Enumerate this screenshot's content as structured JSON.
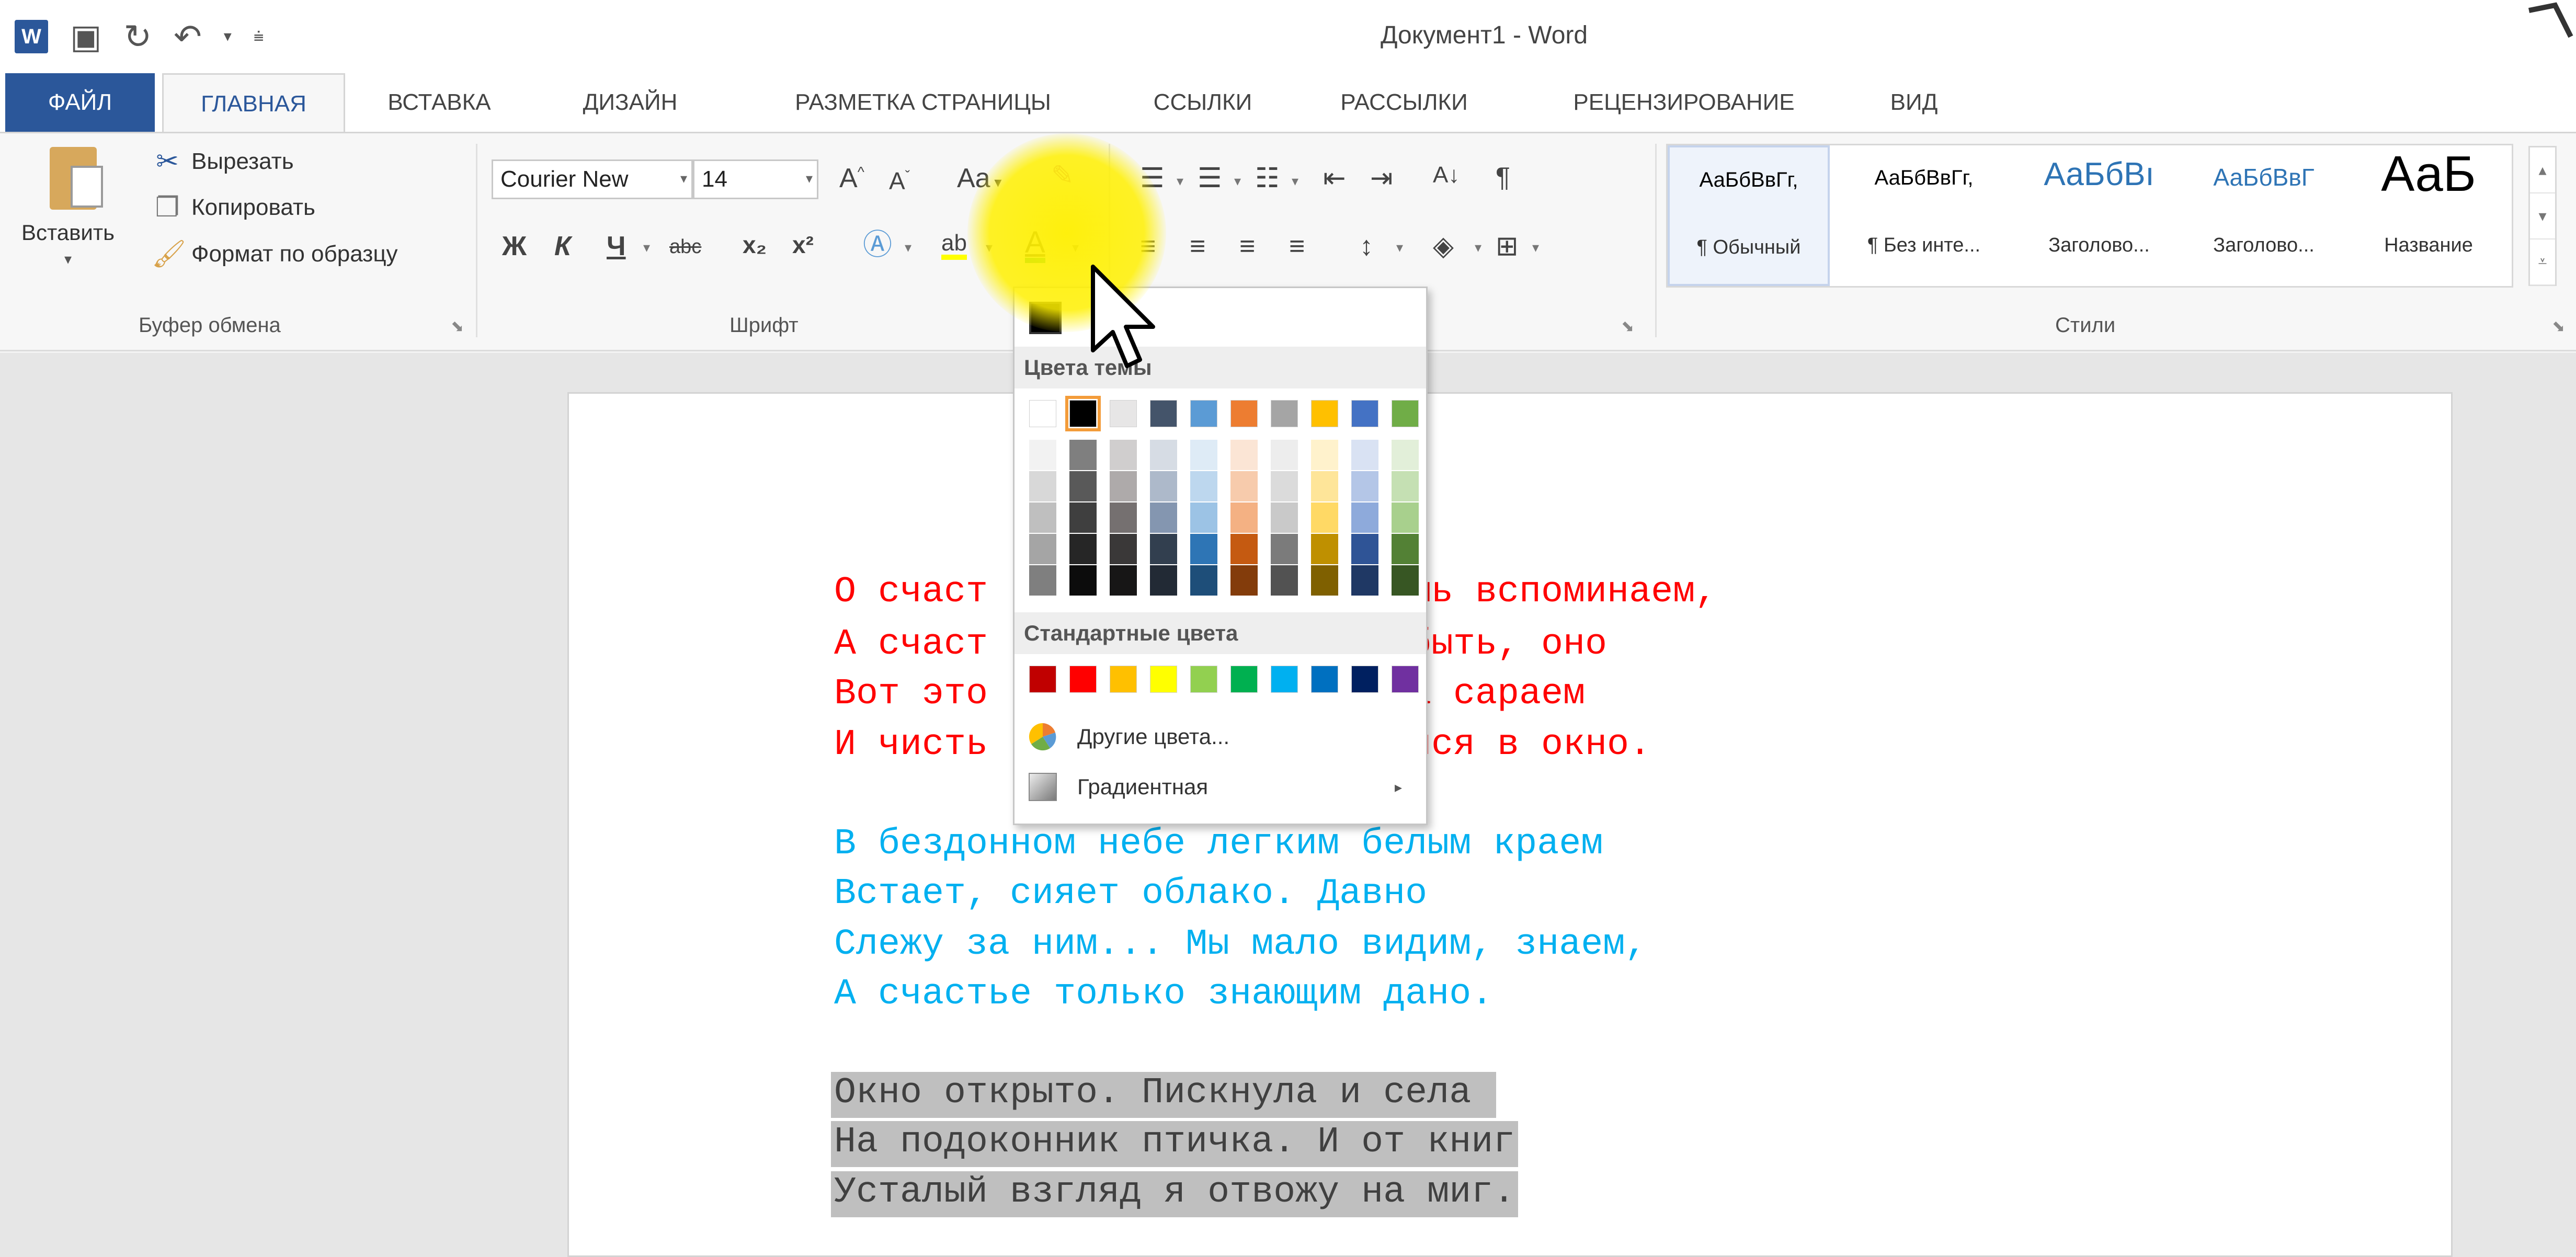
{
  "title": {
    "doc_title": "Документ1 - Word"
  },
  "tabs": [
    "ФАЙЛ",
    "ГЛАВНАЯ",
    "ВСТАВКА",
    "ДИЗАЙН",
    "РАЗМЕТКА СТРАНИЦЫ",
    "ССЫЛКИ",
    "РАССЫЛКИ",
    "РЕЦЕНЗИРОВАНИЕ",
    "ВИД"
  ],
  "clipboard": {
    "paste": "Вставить",
    "cut": "Вырезать",
    "copy": "Копировать",
    "format_painter": "Формат по образцу",
    "label": "Буфер обмена"
  },
  "font": {
    "name": "Courier New",
    "size": "14",
    "grow": "A",
    "shrink": "A",
    "case": "Aa",
    "bold": "Ж",
    "italic": "К",
    "underline": "Ч",
    "strike": "abc",
    "sub": "x₂",
    "sup": "x²",
    "label": "Шрифт"
  },
  "paragraph": {
    "sort": "А↓",
    "pilcrow": "¶"
  },
  "styles": {
    "items": [
      {
        "sample": "АаБбВвГг,",
        "name": "¶ Обычный"
      },
      {
        "sample": "АаБбВвГг,",
        "name": "¶ Без инте..."
      },
      {
        "sample": "АаБбВı",
        "name": "Заголово..."
      },
      {
        "sample": "АаБбВвГ",
        "name": "Заголово..."
      },
      {
        "sample": "АаБ",
        "name": "Название"
      }
    ],
    "label": "Стили"
  },
  "colors": {
    "accent": "#2b579a",
    "theme_top": [
      "#ffffff",
      "#000000",
      "#e7e6e6",
      "#44546a",
      "#5b9bd5",
      "#ed7d31",
      "#a5a5a5",
      "#ffc000",
      "#4472c4",
      "#70ad47"
    ],
    "theme_shades": [
      [
        "#f2f2f2",
        "#7f7f7f",
        "#d0cece",
        "#d6dce4",
        "#deebf6",
        "#fbe5d5",
        "#ededed",
        "#fff2cc",
        "#d9e2f3",
        "#e2efd9"
      ],
      [
        "#d8d8d8",
        "#595959",
        "#aeaaaa",
        "#adb9ca",
        "#bdd7ee",
        "#f7cbac",
        "#dbdbdb",
        "#fee599",
        "#b4c6e7",
        "#c5e0b3"
      ],
      [
        "#bfbfbf",
        "#3f3f3f",
        "#757070",
        "#8496b0",
        "#9cc3e5",
        "#f4b183",
        "#c9c9c9",
        "#ffd965",
        "#8eaadb",
        "#a8d08d"
      ],
      [
        "#a5a5a5",
        "#262626",
        "#3a3838",
        "#323f4f",
        "#2e75b5",
        "#c55a11",
        "#7b7b7b",
        "#bf9000",
        "#2f5496",
        "#538135"
      ],
      [
        "#7f7f7f",
        "#0c0c0c",
        "#171616",
        "#222a35",
        "#1e4e79",
        "#833c0b",
        "#525252",
        "#7f6000",
        "#1f3864",
        "#375623"
      ]
    ],
    "standard": [
      "#c00000",
      "#ff0000",
      "#ffc000",
      "#ffff00",
      "#92d050",
      "#00b050",
      "#00b0f0",
      "#0070c0",
      "#002060",
      "#7030a0"
    ],
    "doc_red": "#ff0000",
    "doc_cyan": "#00b0f0"
  },
  "dropdown": {
    "theme_colors": "Цвета темы",
    "standard_colors": "Стандартные цвета",
    "more_colors": "Другие цвета...",
    "gradient": "Градиентная"
  },
  "document": {
    "stanza1": [
      "О счаст",
      "А счаст",
      "Вот это",
      "И чисть"
    ],
    "stanza1_right": [
      "шь вспоминаем,",
      "быть, оно",
      "а сараем",
      "йся в окно."
    ],
    "stanza2": [
      "В бездонном небе легким белым краем",
      "Встает, сияет облако. Давно",
      "Слежу за ним... Мы мало видим, знаем,",
      "А счастье только знающим дано."
    ],
    "stanza3": [
      "Окно открыто. Пискнула и села ",
      "На подоконник птичка. И от книг",
      "Усталый взгляд я отвожу на миг."
    ]
  }
}
